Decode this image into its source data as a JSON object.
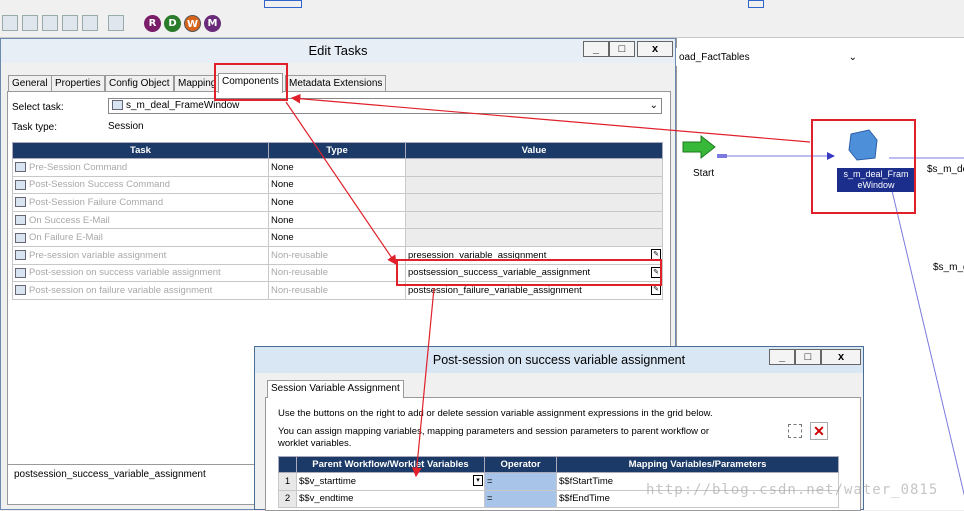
{
  "edit_tasks": {
    "title": "Edit Tasks",
    "tabs": [
      "General",
      "Properties",
      "Config Object",
      "Mapping",
      "Components",
      "Metadata Extensions"
    ],
    "select_task_label": "Select task:",
    "select_task_value": "s_m_deal_FrameWindow",
    "task_type_label": "Task type:",
    "task_type_value": "Session",
    "columns": [
      "Task",
      "Type",
      "Value"
    ],
    "rows": [
      {
        "task": "Pre-Session Command",
        "type": "None",
        "value": ""
      },
      {
        "task": "Post-Session Success Command",
        "type": "None",
        "value": ""
      },
      {
        "task": "Post-Session Failure Command",
        "type": "None",
        "value": ""
      },
      {
        "task": "On Success E-Mail",
        "type": "None",
        "value": ""
      },
      {
        "task": "On Failure E-Mail",
        "type": "None",
        "value": ""
      },
      {
        "task": "Pre-session variable assignment",
        "type": "Non-reusable",
        "value": "presession_variable_assignment"
      },
      {
        "task": "Post-session on success variable assignment",
        "type": "Non-reusable",
        "value": "postsession_success_variable_assignment"
      },
      {
        "task": "Post-session on failure variable assignment",
        "type": "Non-reusable",
        "value": "postsession_failure_variable_assignment"
      }
    ],
    "description": "postsession_success_variable_assignment",
    "minimize": "_",
    "maximize": "□",
    "close": "x"
  },
  "workflow": {
    "selector_value": "oad_FactTables",
    "start_label": "Start",
    "session_node": "s_m_deal_FrameWindow",
    "session_node_line1": "s_m_deal_Fram",
    "session_node_line2": "eWindow",
    "right_label_1": "$s_m_de",
    "right_label_2": "$s_m_d"
  },
  "sub_dialog": {
    "title": "Post-session on success variable assignment",
    "tab": "Session Variable Assignment",
    "instruction_1": "Use the buttons on the right to add or delete session variable assignment expressions in the grid below.",
    "instruction_2": "You can assign mapping variables, mapping parameters and session parameters to parent workflow or",
    "instruction_3": "worklet variables.",
    "columns": [
      "Parent Workflow/Worklet Variables",
      "Operator",
      "Mapping Variables/Parameters"
    ],
    "rows": [
      {
        "n": "1",
        "parent": "$$v_starttime",
        "op": "=",
        "mapping": "$$fStartTime"
      },
      {
        "n": "2",
        "parent": "$$v_endtime",
        "op": "=",
        "mapping": "$$fEndTime"
      }
    ]
  },
  "toolbar_circles": [
    "R",
    "D",
    "W",
    "M"
  ],
  "watermark": "http://blog.csdn.net/water_0815"
}
